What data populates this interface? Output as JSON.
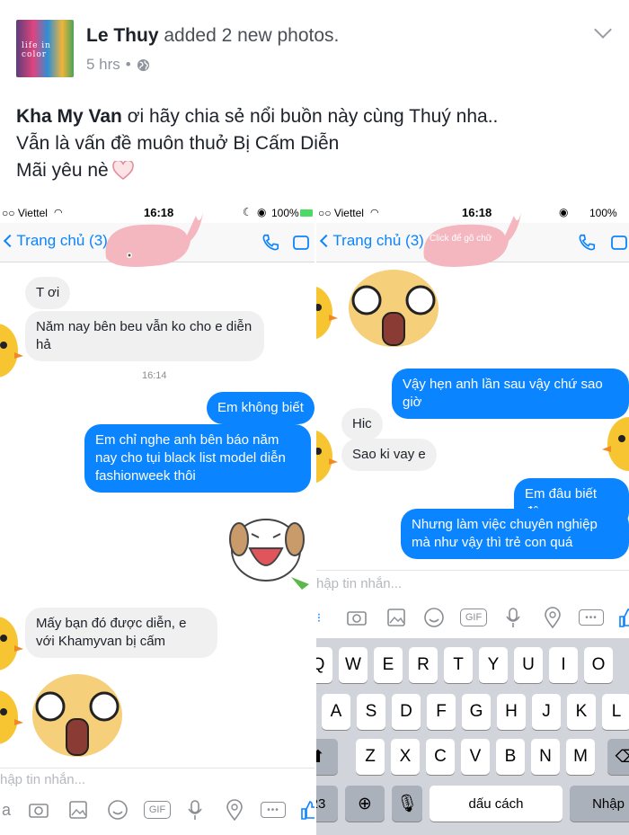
{
  "post": {
    "author": "Le Thuy",
    "action": "added 2 new photos.",
    "time": "5 hrs",
    "dot": "•",
    "caption": {
      "mention": "Kha My Van",
      "line1_rest": " ơi hãy chia sẻ nổi buồn này cùng Thuý nha..",
      "line2": "Vẫn là vấn đề muôn thuở Bị Cấm Diễn",
      "line3": "Mãi yêu nè"
    },
    "avatar_text": "life in color"
  },
  "screenshot_left": {
    "carrier": "○○ Viettel",
    "clock": "16:18",
    "battery": "100%",
    "back_label": "Trang chủ (3)",
    "messages": {
      "in1": "T ơi",
      "in2": "Năm nay bên beu vẫn ko cho e diễn hả",
      "timestamp": "16:14",
      "out1": "Em không biết",
      "out2": "Em chỉ nghe anh bên báo năm nay cho tụi black list model diễn fashionweek thôi",
      "in3": "Mấy bạn đó được diễn, e với Khamyvan bị cấm"
    },
    "composer_placeholder": "hập tin nhắn...",
    "gif_label": "GIF",
    "icons": [
      "camera-icon",
      "photo-icon",
      "smile-icon",
      "gif-icon",
      "mic-icon",
      "location-icon",
      "more-icon",
      "like-icon"
    ]
  },
  "screenshot_right": {
    "carrier": "○○ Viettel",
    "clock": "16:18",
    "battery": "100%",
    "back_label": "Trang chủ (3)",
    "whale_text": "Click để gõ chữ",
    "messages": {
      "out1": "Vậy hẹn anh lần sau vậy chứ sao giờ",
      "in1": "Hic",
      "in2": "Sao ki vay e",
      "out2": "Em đâu biết đâu",
      "out3": "Nhưng làm việc chuyên nghiệp mà như vậy thì trẻ con quá"
    },
    "composer_placeholder": "hập tin nhắn...",
    "gif_label": "GIF",
    "keyboard": {
      "row1": [
        "Q",
        "W",
        "E",
        "R",
        "T",
        "Y",
        "U",
        "I",
        "O"
      ],
      "row2": [
        "A",
        "S",
        "D",
        "F",
        "G",
        "H",
        "J",
        "K",
        "L"
      ],
      "row3": [
        "Z",
        "X",
        "C",
        "V",
        "B",
        "N",
        "M"
      ],
      "numbers_key": "23",
      "space_key": "dấu cách",
      "return_key": "Nhập"
    }
  },
  "colors": {
    "messenger_blue": "#0a84ff",
    "incoming_bubble": "#f1f0f0",
    "whale_pink": "#f4b6bf",
    "chick_yellow": "#f7c531"
  }
}
